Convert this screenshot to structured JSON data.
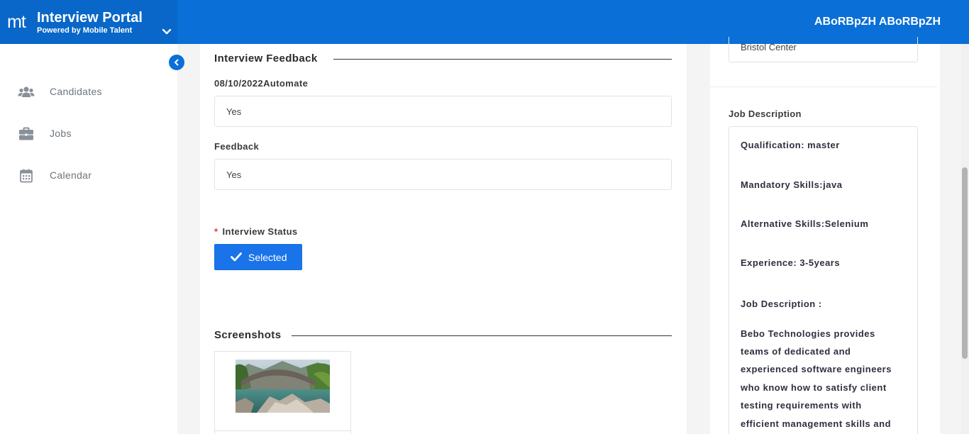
{
  "app": {
    "logo_text": "mt",
    "title": "Interview Portal",
    "subtitle": "Powered by Mobile Talent",
    "user_name": "ABoRBpZH ABoRBpZH",
    "brand_color": "#0a6fd6"
  },
  "sidebar": {
    "items": [
      {
        "label": "Candidates",
        "icon": "users-icon"
      },
      {
        "label": "Jobs",
        "icon": "briefcase-icon"
      },
      {
        "label": "Calendar",
        "icon": "calendar-icon"
      }
    ]
  },
  "feedback": {
    "section_title": "Interview Feedback",
    "question_label": "08/10/2022Automate",
    "question_value": "Yes",
    "feedback_label": "Feedback",
    "feedback_value": "Yes",
    "status_required_mark": "*",
    "status_label": "Interview Status",
    "status_value": "Selected"
  },
  "screenshots": {
    "section_title": "Screenshots"
  },
  "job": {
    "location_value": "Bristol Center",
    "description_label": "Job Description",
    "description_lines": [
      "Qualification: master",
      "Mandatory Skills:java",
      "Alternative Skills:Selenium",
      "Experience: 3-5years",
      "Job Description :",
      "Bebo Technologies provides",
      "teams of dedicated and",
      "experienced software engineers",
      "who know how to satisfy client",
      "testing requirements with",
      "efficient management skills and"
    ]
  }
}
